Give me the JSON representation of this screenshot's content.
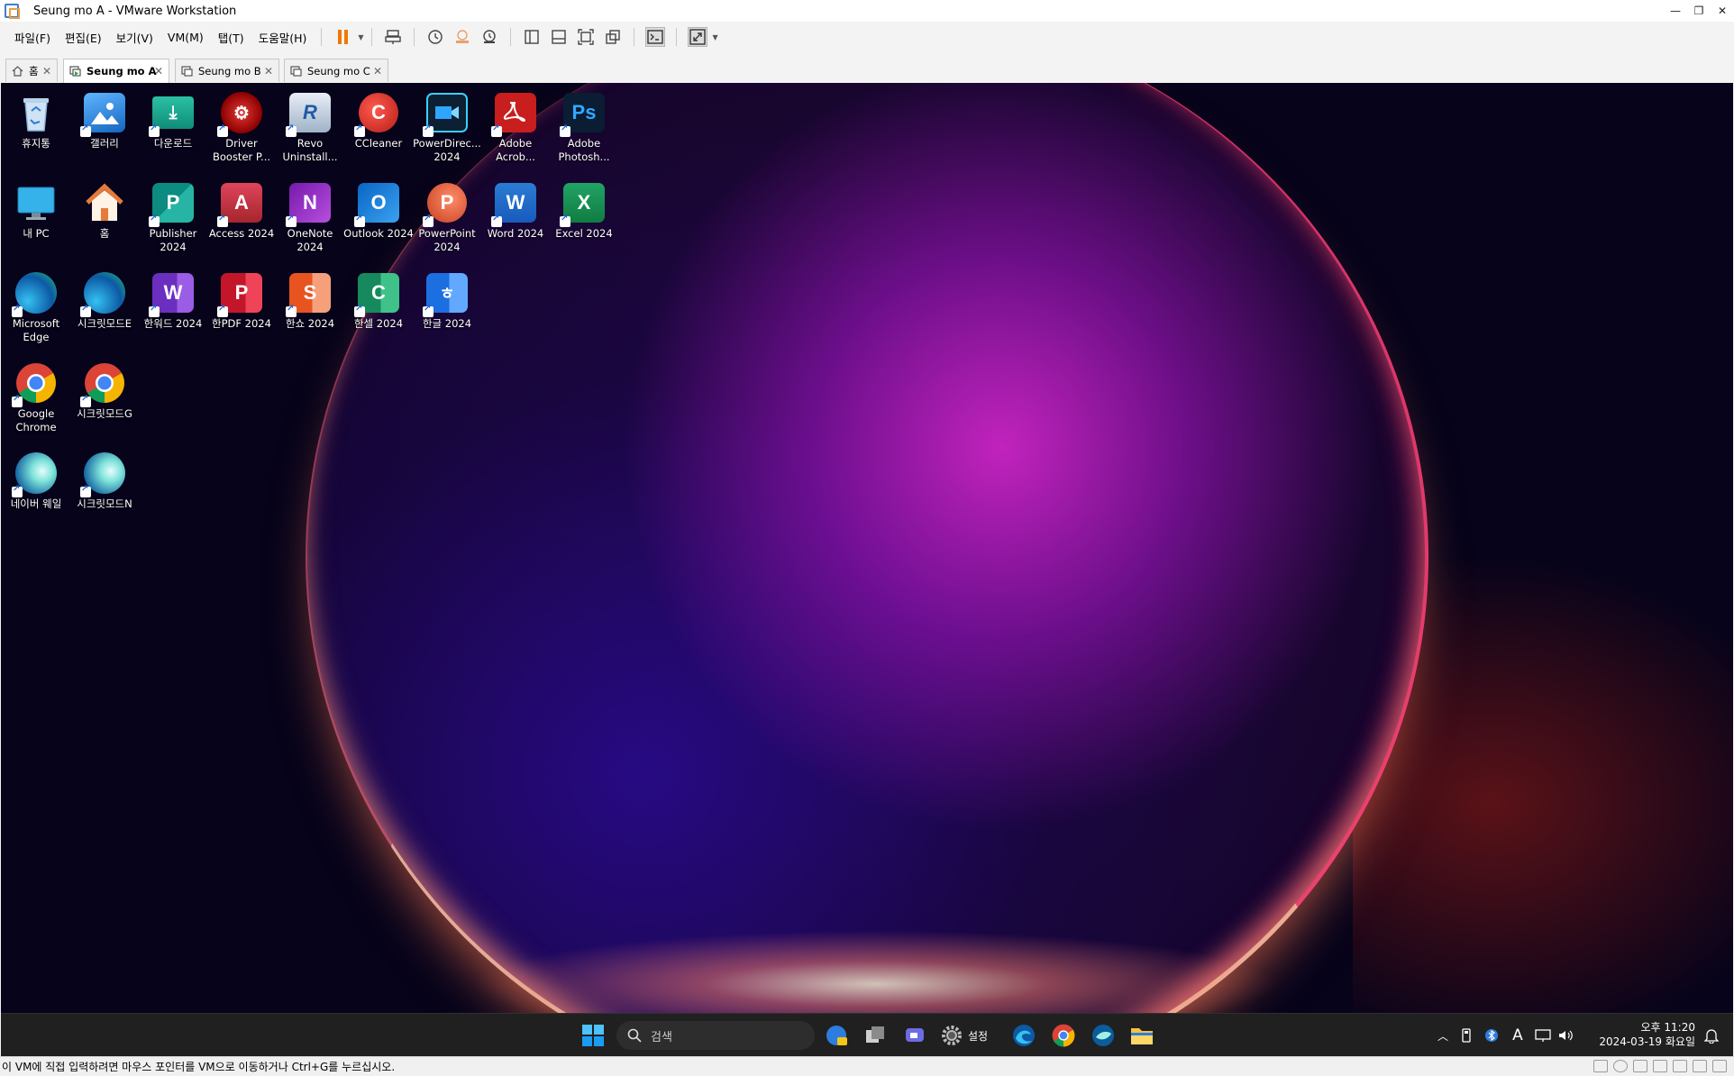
{
  "window": {
    "title": "Seung mo A - VMware Workstation"
  },
  "menu": [
    "파일(F)",
    "편집(E)",
    "보기(V)",
    "VM(M)",
    "탭(T)",
    "도움말(H)"
  ],
  "tabs": [
    {
      "label": "홈",
      "icon": "home-icon",
      "active": false
    },
    {
      "label": "Seung mo A",
      "icon": "vm-icon",
      "active": true
    },
    {
      "label": "Seung mo B",
      "icon": "vm-icon",
      "active": false
    },
    {
      "label": "Seung mo C",
      "icon": "vm-icon",
      "active": false
    }
  ],
  "desktop": {
    "icons": [
      {
        "label": "휴지통",
        "icon": "recycle-bin-icon",
        "shortcut": false
      },
      {
        "label": "갤러리",
        "icon": "gallery-icon",
        "shortcut": true
      },
      {
        "label": "다운로드",
        "icon": "downloads-folder-icon",
        "shortcut": true
      },
      {
        "label": "Driver Booster P...",
        "icon": "driver-booster-icon",
        "shortcut": true
      },
      {
        "label": "Revo Uninstall...",
        "icon": "revo-uninstaller-icon",
        "shortcut": true
      },
      {
        "label": "CCleaner",
        "icon": "ccleaner-icon",
        "shortcut": true
      },
      {
        "label": "PowerDirec... 2024",
        "icon": "powerdirector-icon",
        "shortcut": true
      },
      {
        "label": "Adobe Acrob...",
        "icon": "adobe-acrobat-icon",
        "shortcut": true
      },
      {
        "label": "Adobe Photosh...",
        "icon": "adobe-photoshop-icon",
        "shortcut": true
      },
      {
        "label": "내 PC",
        "icon": "this-pc-icon",
        "shortcut": false
      },
      {
        "label": "홈",
        "icon": "home-folder-icon",
        "shortcut": false
      },
      {
        "label": "Publisher 2024",
        "icon": "publisher-icon",
        "shortcut": true
      },
      {
        "label": "Access 2024",
        "icon": "access-icon",
        "shortcut": true
      },
      {
        "label": "OneNote 2024",
        "icon": "onenote-icon",
        "shortcut": true
      },
      {
        "label": "Outlook 2024",
        "icon": "outlook-icon",
        "shortcut": true
      },
      {
        "label": "PowerPoint 2024",
        "icon": "powerpoint-icon",
        "shortcut": true
      },
      {
        "label": "Word 2024",
        "icon": "word-icon",
        "shortcut": true
      },
      {
        "label": "Excel 2024",
        "icon": "excel-icon",
        "shortcut": true
      },
      {
        "label": "Microsoft Edge",
        "icon": "edge-icon",
        "shortcut": true
      },
      {
        "label": "시크릿모드E",
        "icon": "edge-icon",
        "shortcut": true
      },
      {
        "label": "한워드 2024",
        "icon": "hanword-icon",
        "shortcut": true
      },
      {
        "label": "한PDF 2024",
        "icon": "hanpdf-icon",
        "shortcut": true
      },
      {
        "label": "한쇼 2024",
        "icon": "hanshow-icon",
        "shortcut": true
      },
      {
        "label": "한셀 2024",
        "icon": "hancell-icon",
        "shortcut": true
      },
      {
        "label": "한글 2024",
        "icon": "hangul-icon",
        "shortcut": true
      },
      {
        "label": "Google Chrome",
        "icon": "chrome-icon",
        "shortcut": true
      },
      {
        "label": "시크릿모드G",
        "icon": "chrome-icon",
        "shortcut": true
      },
      {
        "label": "네이버 웨일",
        "icon": "whale-icon",
        "shortcut": true
      },
      {
        "label": "시크릿모드N",
        "icon": "whale-icon",
        "shortcut": true
      }
    ]
  },
  "taskbar": {
    "search_placeholder": "검색",
    "settings_label": "설정",
    "clock_time": "오후 11:20",
    "clock_date": "2024-03-19 화요일",
    "ime_label": "A"
  },
  "statusbar": {
    "message": "이 VM에 직접 입력하려면 마우스 포인터를 VM으로 이동하거나 Ctrl+G를 누르십시오."
  }
}
